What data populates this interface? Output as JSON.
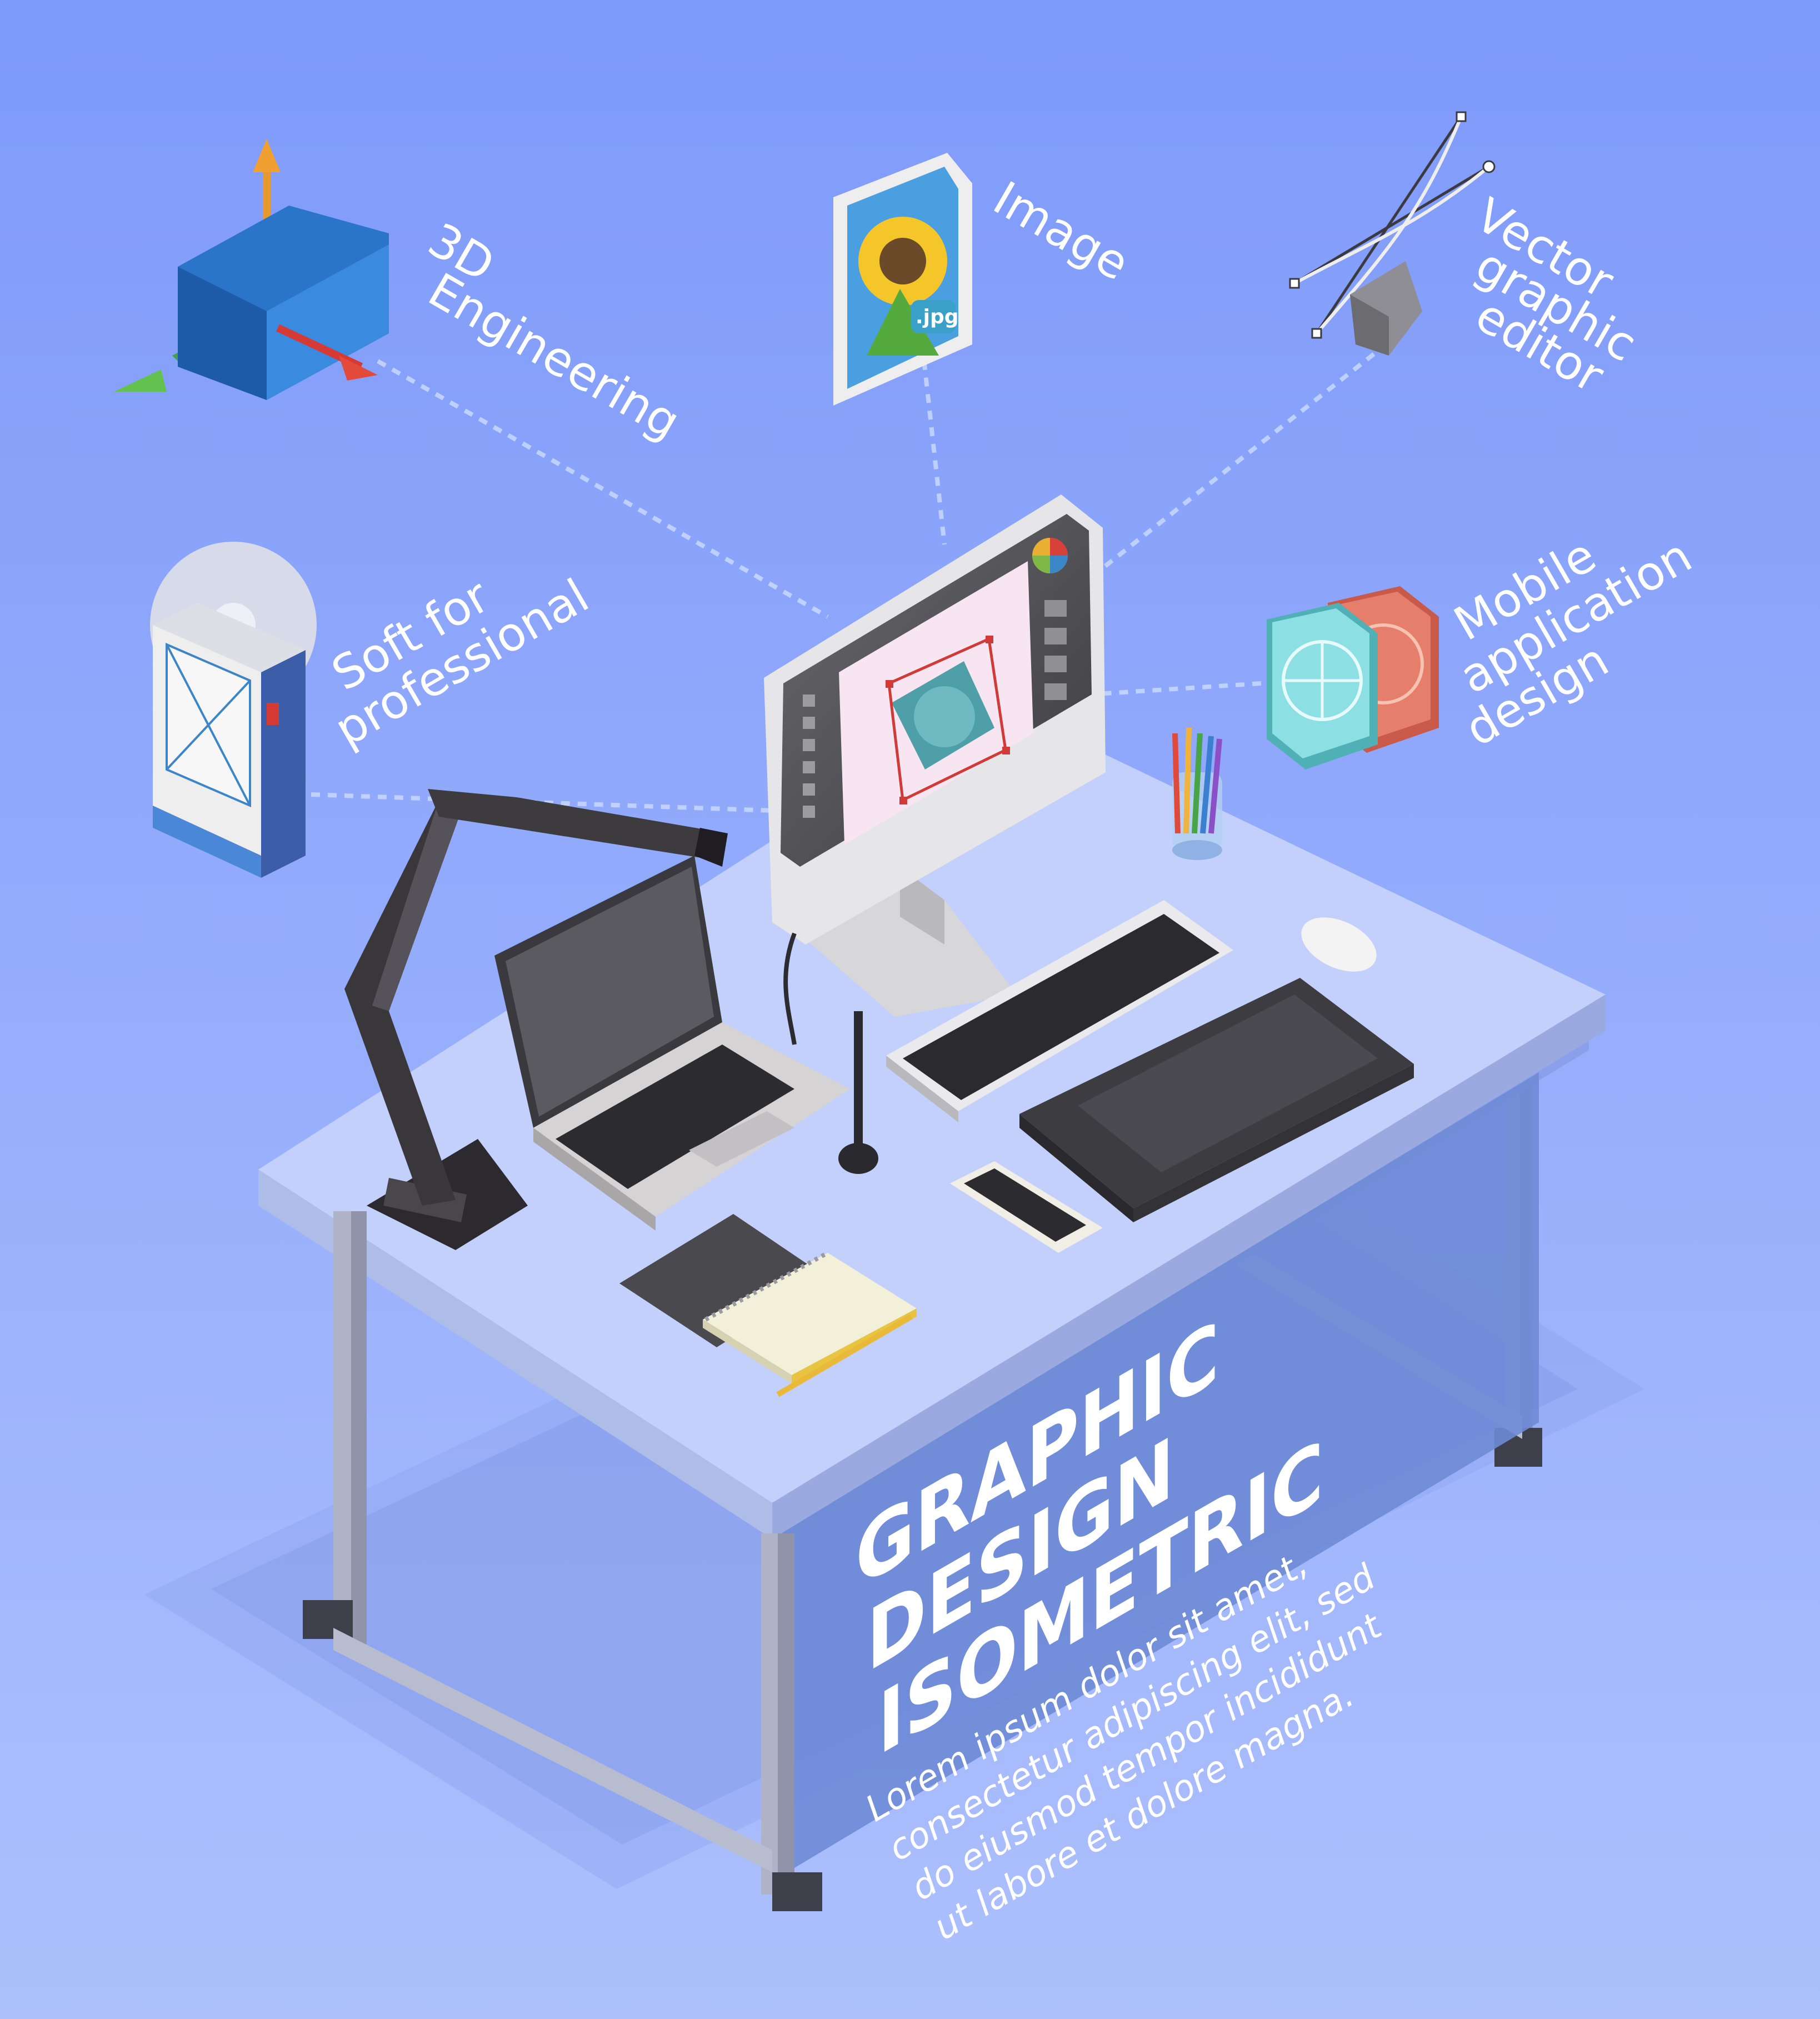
{
  "features": [
    {
      "id": "3d",
      "label_lines": [
        "3D",
        "Engineering"
      ],
      "icon": "3d-axes-icon"
    },
    {
      "id": "image",
      "label_lines": [
        "Image"
      ],
      "icon": "image-file-icon"
    },
    {
      "id": "vector",
      "label_lines": [
        "Vector",
        "graphic",
        "editor"
      ],
      "icon": "pen-tool-icon"
    },
    {
      "id": "soft",
      "label_lines": [
        "Soft for",
        "professional"
      ],
      "icon": "software-box-icon"
    },
    {
      "id": "mobile",
      "label_lines": [
        "Mobile",
        "application",
        "design"
      ],
      "icon": "app-icons-icon"
    }
  ],
  "jpg_badge": ".jpg",
  "headline": {
    "lines": [
      "GRAPHIC",
      "DESIGN",
      "ISOMETRIC"
    ]
  },
  "body_text": {
    "lines": [
      "Lorem ipsum dolor sit amet,",
      "consectetur adipiscing elit, sed",
      "do eiusmod tempor incididunt",
      "ut labore et dolore magna."
    ]
  },
  "colors": {
    "background_top": "#7f9bfa",
    "background_bottom": "#a8bcfc",
    "table_top": "#c9d6fd",
    "accent_red": "#e04a3a",
    "accent_teal": "#5fc6cf"
  }
}
